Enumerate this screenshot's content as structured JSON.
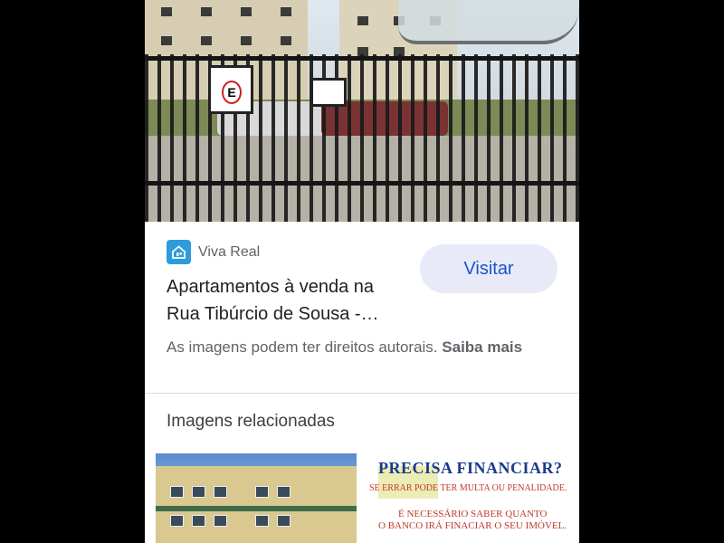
{
  "source": {
    "site_name": "Viva Real",
    "site_icon": "house-logo-icon",
    "brand_color": "#2d9cdb"
  },
  "title": "Apartamentos à venda na Rua Tibúrcio de Sousa -…",
  "visit_button": "Visitar",
  "rights": {
    "text": "As imagens podem ter direitos autorais.",
    "link": "Saiba mais"
  },
  "related": {
    "heading": "Imagens relacionadas",
    "promo": {
      "title": "PRECISA FINANCIAR?",
      "warning": "SE ERRAR PODE TER MULTA OU PENALIDADE.",
      "line1": "É NECESSÁRIO SABER QUANTO",
      "line2": "O BANCO IRÁ FINACIAR O SEU IMÓVEL."
    }
  },
  "colors": {
    "accent": "#1a56c8",
    "button_bg": "#e8eaf8",
    "text_primary": "#202124",
    "text_secondary": "#5f6368"
  }
}
